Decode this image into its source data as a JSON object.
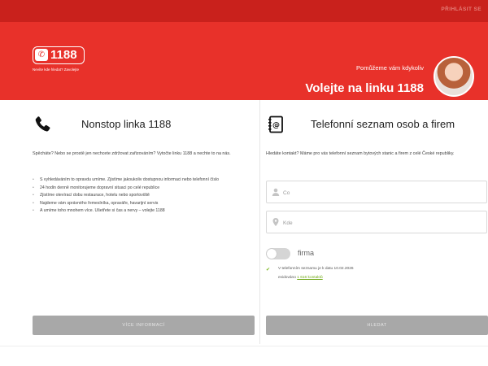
{
  "topbar": {
    "login": "PŘIHLÁSIT SE"
  },
  "brand": {
    "number": "1188",
    "tagline": "Nevíte kde hledat? Zavolejte"
  },
  "hero": {
    "subtitle": "Pomůžeme vám kdykoliv",
    "title": "Volejte na linku 1188"
  },
  "left_panel": {
    "title": "Nonstop linka 1188",
    "intro": "Spěcháte? Nebo se prostě jen nechcete zdržovat zařizováním? Vytočte linku 1188 a nechte to na nás.",
    "bullets": [
      "S vyhledáváním to opravdu umíme. Zjistíme jakoukoliv dostupnou informaci nebo telefonní číslo",
      "24 hodin denně monitorujeme dopravní situaci po celé republice",
      "Zjistíme otevírací dobu restaurace, hotelu nebo sportoviště",
      "Najdeme vám správného řemeslníka, opraváře, havarijní servis",
      "A umíme toho mnohem více. Ušetřete si čas a nervy – volejte 1188"
    ],
    "button": "VÍCE INFORMACÍ"
  },
  "right_panel": {
    "title": "Telefonní seznam osob a firem",
    "intro": "Hledáte kontakt? Máme pro vás telefonní seznam bytových stanic a firem z celé České republiky.",
    "what_placeholder": "Co",
    "where_placeholder": "Kde",
    "toggle_label": "firma",
    "note_line1": "V telefonním seznamu je k datu 10.02.2026",
    "note_prefix": "evidováno",
    "note_link": "1 616 kontaktů",
    "button": "HLEDAT"
  },
  "colors": {
    "brand_red": "#e8312a",
    "topbar_red": "#c9211c",
    "button_grey": "#a8a8a8",
    "accent_green": "#7ab91d"
  },
  "icons": [
    "phone-icon",
    "address-book-icon",
    "user-icon",
    "location-pin-icon",
    "check-icon"
  ]
}
